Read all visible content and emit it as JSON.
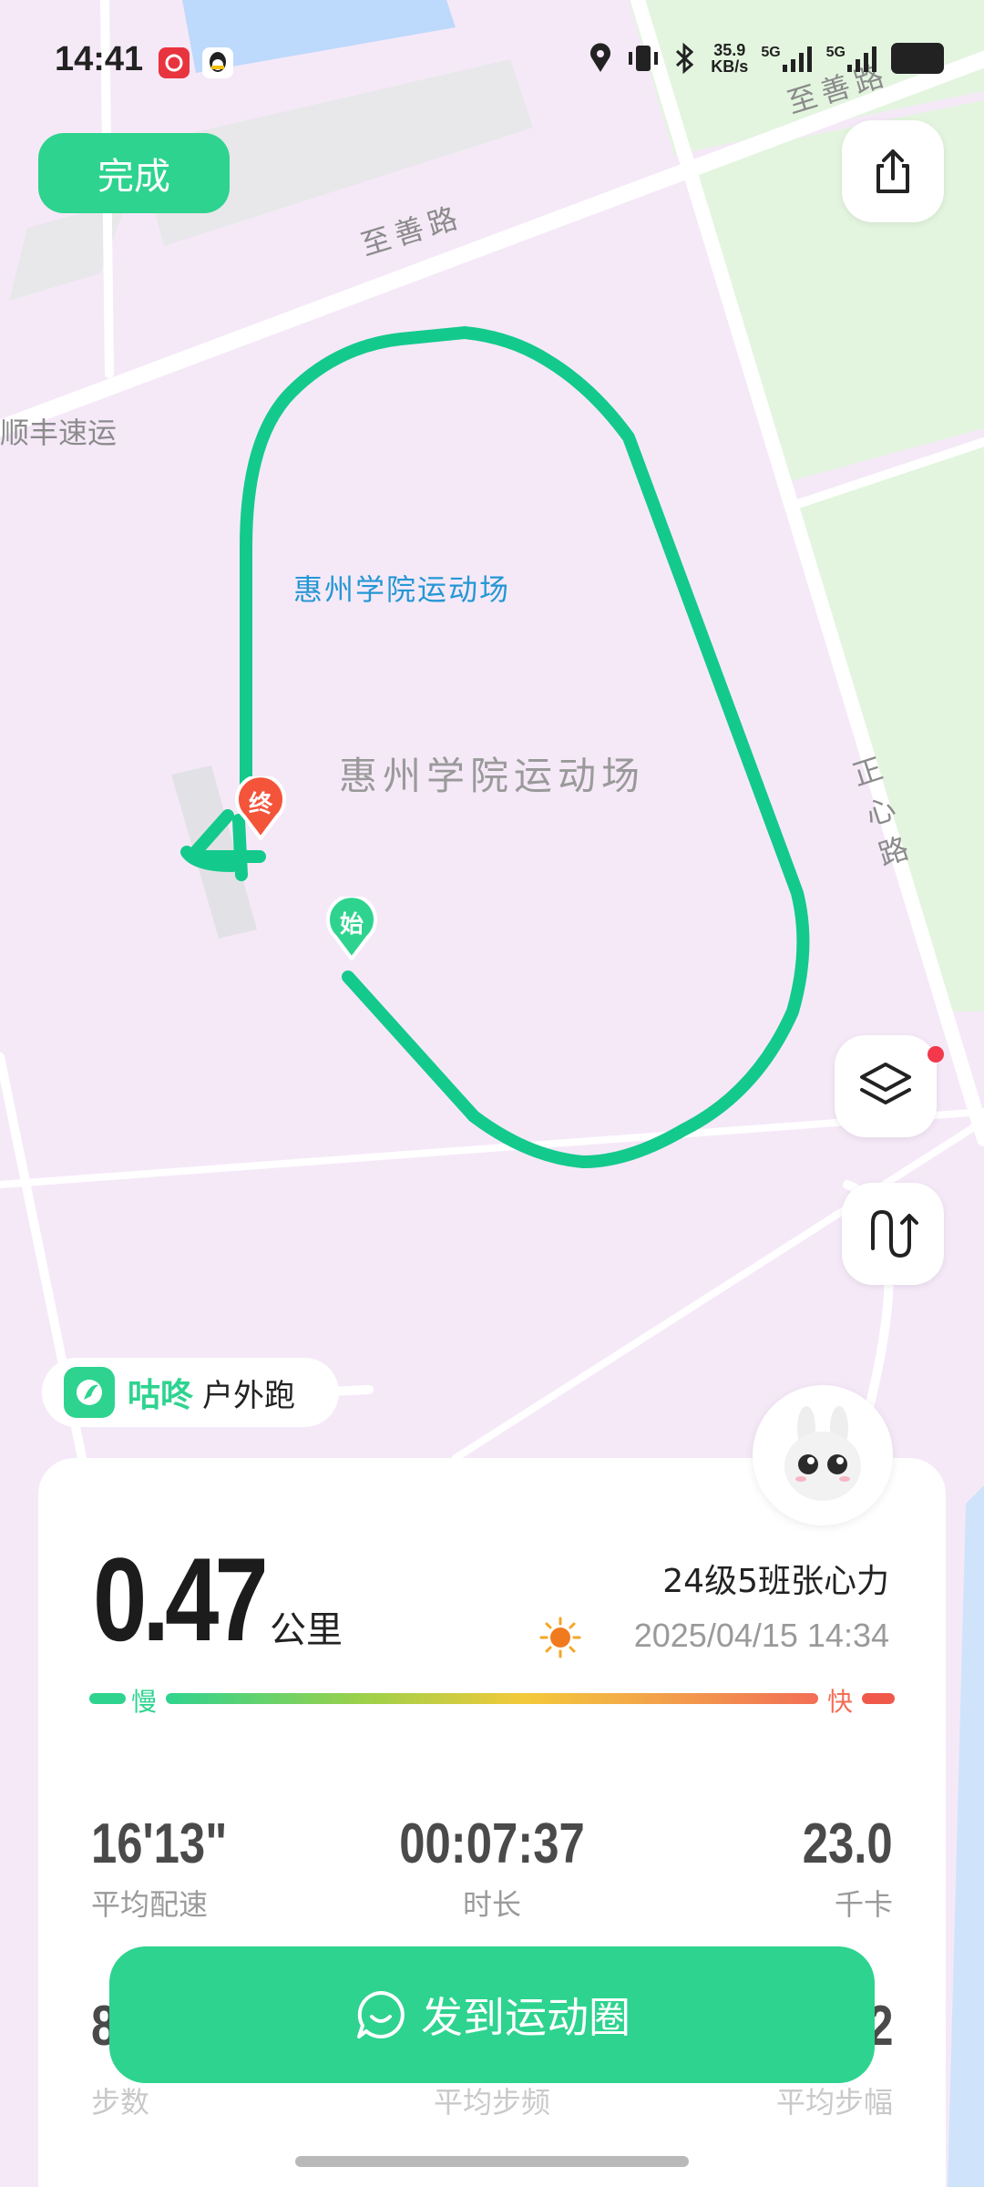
{
  "status_bar": {
    "time": "14:41",
    "net_speed_value": "35.9",
    "net_speed_unit": "KB/s",
    "sim1": "5G",
    "sim2": "5G",
    "icons": [
      "netease-music-icon",
      "qq-icon",
      "location-icon",
      "vibrate-icon",
      "bluetooth-icon",
      "signal-icon",
      "battery-icon"
    ]
  },
  "header": {
    "done_label": "完成",
    "share_icon": "share-icon"
  },
  "map": {
    "road_top": "至善路",
    "road_top_right": "至善路",
    "road_right": "正心路",
    "place_left": "顺丰速运",
    "stadium_poi": "惠州学院运动场",
    "stadium_area": "惠州学院运动场",
    "start_marker": "始",
    "end_marker": "终",
    "route_color": "#14c98c",
    "layers_icon": "layers-icon",
    "route_toggle_icon": "route-icon"
  },
  "brand": {
    "name": "咕咚",
    "activity": "户外跑",
    "color": "#2ed38f"
  },
  "summary": {
    "distance": "0.47",
    "distance_unit": "公里",
    "runner": "24级5班张心力",
    "datetime": "2025/04/15 14:34",
    "weather_icon": "sun-icon",
    "pace_slow": "慢",
    "pace_fast": "快"
  },
  "stats": [
    {
      "value": "16'13\"",
      "label": "平均配速"
    },
    {
      "value": "00:07:37",
      "label": "时长"
    },
    {
      "value": "23.0",
      "label": "千卡"
    }
  ],
  "stats_row2": {
    "labels": [
      "步数",
      "平均步频",
      "平均步幅"
    ],
    "left_value_partial": "8",
    "right_value_partial": "2"
  },
  "post_button": {
    "label": "发到运动圈"
  }
}
